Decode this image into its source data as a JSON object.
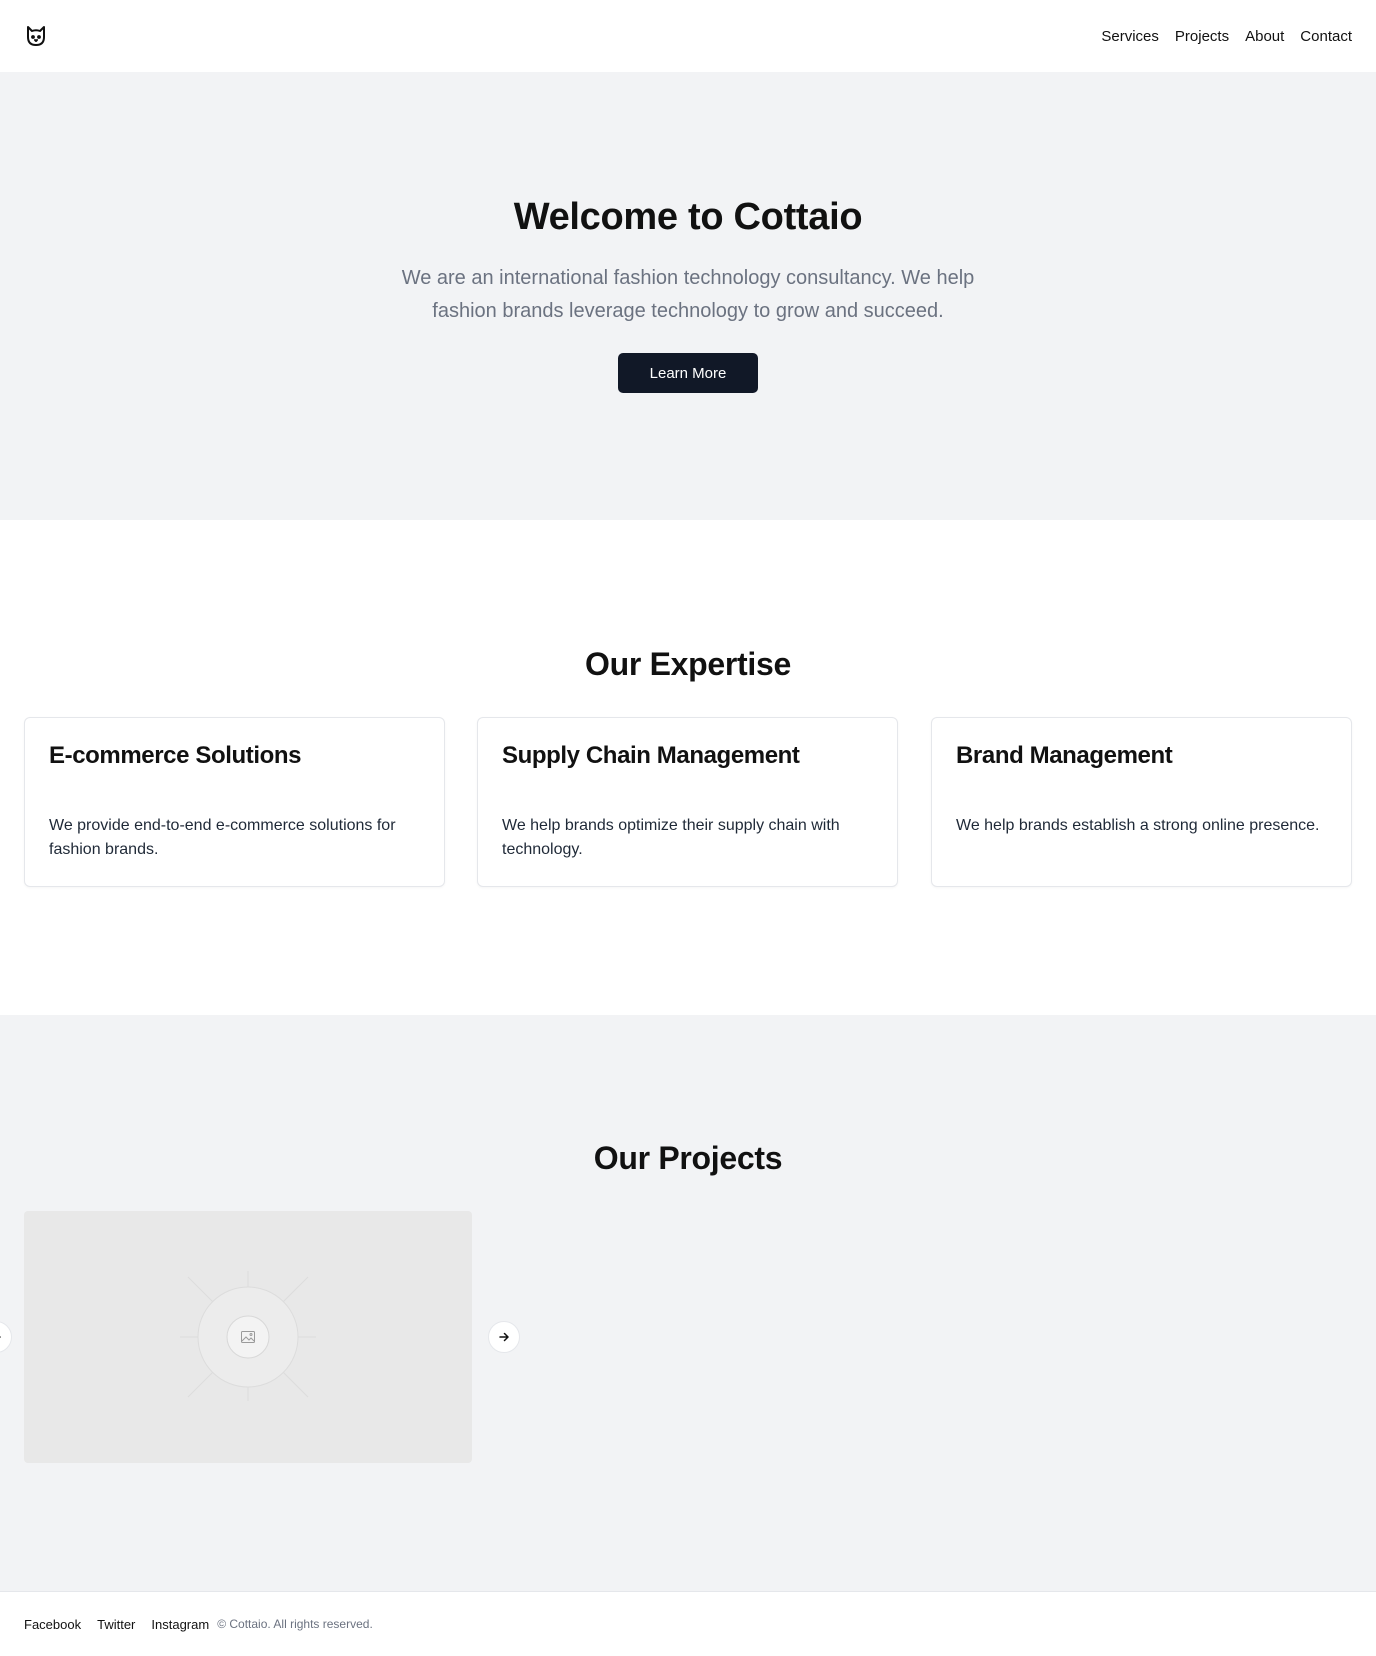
{
  "header": {
    "logo_icon": "cat-face-icon",
    "nav": [
      {
        "label": "Services"
      },
      {
        "label": "Projects"
      },
      {
        "label": "About"
      },
      {
        "label": "Contact"
      }
    ]
  },
  "hero": {
    "title": "Welcome to Cottaio",
    "subtitle": "We are an international fashion technology consultancy. We help fashion brands leverage technology to grow and succeed.",
    "button_label": "Learn More"
  },
  "expertise": {
    "title": "Our Expertise",
    "cards": [
      {
        "title": "E-commerce Solutions",
        "description": "We provide end-to-end e-commerce solutions for fashion brands."
      },
      {
        "title": "Supply Chain Management",
        "description": "We help brands optimize their supply chain with technology."
      },
      {
        "title": "Brand Management",
        "description": "We help brands establish a strong online presence."
      }
    ]
  },
  "projects": {
    "title": "Our Projects",
    "image_placeholder_icon": "image-placeholder-icon",
    "next_icon": "arrow-right-icon",
    "prev_icon": "arrow-left-icon"
  },
  "footer": {
    "links": [
      {
        "label": "Facebook"
      },
      {
        "label": "Twitter"
      },
      {
        "label": "Instagram"
      }
    ],
    "copyright": "© Cottaio. All rights reserved."
  },
  "colors": {
    "primary_button": "#111827",
    "section_bg": "#f2f3f5",
    "muted_text": "#6b7280",
    "border": "#e5e7eb"
  }
}
